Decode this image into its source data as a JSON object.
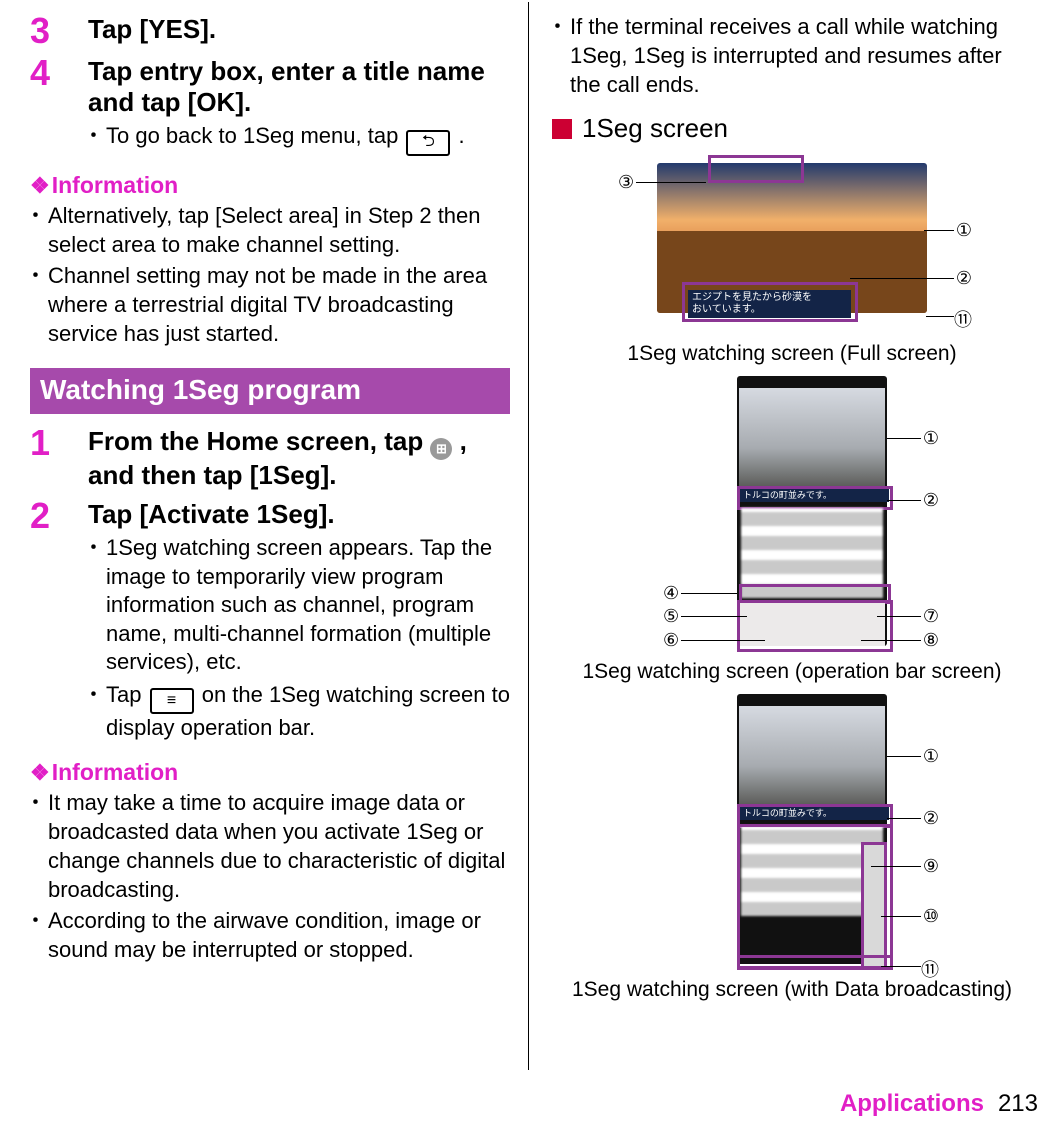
{
  "left": {
    "step3": {
      "num": "3",
      "title": "Tap [YES]."
    },
    "step4": {
      "num": "4",
      "title": "Tap entry box, enter a title name and tap [OK].",
      "sub_prefix": "To go back to 1Seg menu, tap ",
      "sub_suffix": "."
    },
    "info_heading": "Information",
    "info_items": [
      "Alternatively, tap [Select area] in Step 2 then select area to make channel setting.",
      "Channel setting may not be made in the area where a terrestrial digital TV broadcasting service has just started."
    ],
    "section_bar": "Watching 1Seg program",
    "stepW1": {
      "num": "1",
      "title_a": "From the Home screen, tap ",
      "title_b": ", and then tap [1Seg]."
    },
    "stepW2": {
      "num": "2",
      "title": "Tap [Activate 1Seg].",
      "subs": [
        "1Seg watching screen appears. Tap the image to temporarily view program information such as channel, program name, multi-channel formation (multiple services), etc."
      ],
      "sub2_a": "Tap ",
      "sub2_b": " on the 1Seg watching screen to display operation bar."
    },
    "info2_items": [
      "It may take a time to acquire image data or broadcasted data when you activate 1Seg or change channels due to characteristic of digital broadcasting.",
      "According to the airwave condition, image or sound may be interrupted or stopped."
    ]
  },
  "right": {
    "top_bullet": "If the terminal receives a call while watching 1Seg, 1Seg is interrupted and resumes after the call ends.",
    "heading": "1Seg screen",
    "caption1": "1Seg watching screen (Full screen)",
    "caption2": "1Seg watching screen (operation bar screen)",
    "caption3": "1Seg watching screen (with Data broadcasting)",
    "subtitle_jp_a": "エジプトを見たから砂漠を",
    "subtitle_jp_b": "おいています。",
    "subtitle_jp_c": "トルコの町並みです。",
    "callouts": {
      "c1": "①",
      "c2": "②",
      "c3": "③",
      "c4": "④",
      "c5": "⑤",
      "c6": "⑥",
      "c7": "⑦",
      "c8": "⑧",
      "c9": "⑨",
      "c10": "⑩",
      "c11": "⑪"
    }
  },
  "footer": {
    "apps": "Applications",
    "page": "213"
  }
}
